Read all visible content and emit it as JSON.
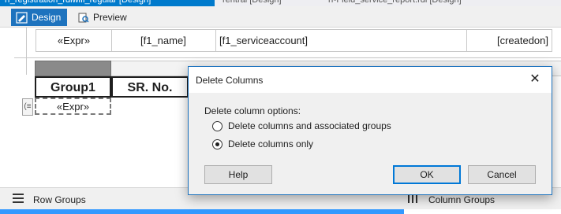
{
  "document_tabs": [
    {
      "label": "rf_registration_rdlwifi_regular [Design]"
    },
    {
      "label": "rentral [Design]"
    },
    {
      "label": "rf-Field_service_report.rdl [Design]"
    }
  ],
  "mode_tabs": {
    "design_label": "Design",
    "preview_label": "Preview"
  },
  "table_top": {
    "cells": [
      "«Expr»",
      "[f1_name]",
      "[f1_serviceaccount]",
      "[createdon]"
    ]
  },
  "table_main": {
    "headers": [
      "Group1",
      "SR. No."
    ],
    "expr_cell": "«Expr»",
    "row_handle": "(≡"
  },
  "groups": {
    "row_groups_label": "Row Groups",
    "column_groups_label": "Column Groups"
  },
  "dialog": {
    "title": "Delete Columns",
    "close_glyph": "✕",
    "section_label": "Delete column options:",
    "options": [
      {
        "label": "Delete columns and associated groups",
        "selected": false
      },
      {
        "label": "Delete columns only",
        "selected": true
      }
    ],
    "help_label": "Help",
    "ok_label": "OK",
    "cancel_label": "Cancel"
  },
  "icons": {
    "design": "design-icon",
    "preview": "preview-icon",
    "row_groups": "row-groups-icon",
    "column_groups": "column-groups-icon"
  },
  "colors": {
    "accent": "#1e73be",
    "dialog_border": "#1e73be",
    "primary_button_border": "#0078d7"
  }
}
